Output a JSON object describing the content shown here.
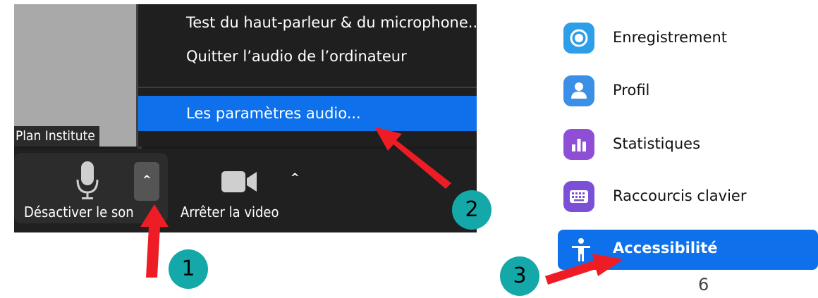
{
  "video_tile": {
    "participant_name": "Plan Institute"
  },
  "audio_menu": {
    "items": [
      {
        "label": "Test du haut-parleur & du microphone..."
      },
      {
        "label": "Quitter l’audio de l’ordinateur"
      },
      {
        "label": "Les paramètres audio..."
      }
    ],
    "selected_index": 2
  },
  "toolbar": {
    "mute_label": "Désactiver le son",
    "video_label": "Arrêter la video",
    "caret_glyph": "^"
  },
  "settings_sidebar": {
    "items": [
      {
        "label": "Enregistrement",
        "icon": "record-icon",
        "color": "#2d9ee8"
      },
      {
        "label": "Profil",
        "icon": "profile-icon",
        "color": "#3b8fe6"
      },
      {
        "label": "Statistiques",
        "icon": "statistics-icon",
        "color": "#8e4fd6"
      },
      {
        "label": "Raccourcis clavier",
        "icon": "keyboard-icon",
        "color": "#7b4fd6"
      },
      {
        "label": "Accessibilité",
        "icon": "accessibility-icon",
        "active": true
      }
    ],
    "active_color": "#0e71eb"
  },
  "annotations": {
    "step_1": "1",
    "step_2": "2",
    "step_3": "3",
    "arrow_color": "#ee1c24",
    "badge_color": "#15a8a8"
  },
  "page_number": "6"
}
